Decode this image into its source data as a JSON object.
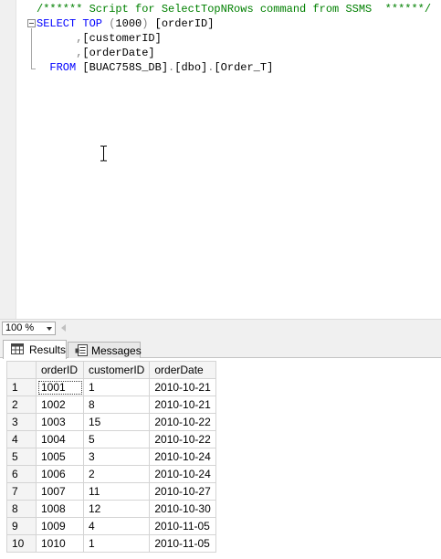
{
  "editor": {
    "lines": [
      {
        "parts": [
          {
            "t": "/****** Script for SelectTopNRows command from SSMS  ******/",
            "c": "c-comment"
          }
        ]
      },
      {
        "parts": [
          {
            "t": "SELECT TOP ",
            "c": "c-kw"
          },
          {
            "t": "(",
            "c": "c-gray"
          },
          {
            "t": "1000",
            "c": "c-plain"
          },
          {
            "t": ")",
            "c": "c-gray"
          },
          {
            "t": " [orderID]",
            "c": "c-plain"
          }
        ]
      },
      {
        "parts": [
          {
            "t": "      ",
            "c": "c-plain"
          },
          {
            "t": ",",
            "c": "c-gray"
          },
          {
            "t": "[customerID]",
            "c": "c-plain"
          }
        ]
      },
      {
        "parts": [
          {
            "t": "      ",
            "c": "c-plain"
          },
          {
            "t": ",",
            "c": "c-gray"
          },
          {
            "t": "[orderDate]",
            "c": "c-plain"
          }
        ]
      },
      {
        "parts": [
          {
            "t": "  FROM ",
            "c": "c-kw"
          },
          {
            "t": "[BUAC758S_DB]",
            "c": "c-plain"
          },
          {
            "t": ".",
            "c": "c-gray"
          },
          {
            "t": "[dbo]",
            "c": "c-plain"
          },
          {
            "t": ".",
            "c": "c-gray"
          },
          {
            "t": "[Order_T]",
            "c": "c-plain"
          }
        ]
      }
    ]
  },
  "zoom": {
    "value": "100 %"
  },
  "tabs": {
    "results": "Results",
    "messages": "Messages"
  },
  "grid": {
    "columns": [
      "orderID",
      "customerID",
      "orderDate"
    ],
    "rows": [
      [
        "1",
        "1001",
        "1",
        "2010-10-21"
      ],
      [
        "2",
        "1002",
        "8",
        "2010-10-21"
      ],
      [
        "3",
        "1003",
        "15",
        "2010-10-22"
      ],
      [
        "4",
        "1004",
        "5",
        "2010-10-22"
      ],
      [
        "5",
        "1005",
        "3",
        "2010-10-24"
      ],
      [
        "6",
        "1006",
        "2",
        "2010-10-24"
      ],
      [
        "7",
        "1007",
        "11",
        "2010-10-27"
      ],
      [
        "8",
        "1008",
        "12",
        "2010-10-30"
      ],
      [
        "9",
        "1009",
        "4",
        "2010-11-05"
      ],
      [
        "10",
        "1010",
        "1",
        "2010-11-05"
      ]
    ]
  },
  "colors": {
    "comment": "#008000",
    "keyword": "#0000ff",
    "operator": "#808080"
  },
  "icons": {
    "fold": "collapse-minus-icon",
    "results": "grid-table-icon",
    "messages": "messages-list-icon",
    "cursor": "text-ibeam-cursor"
  }
}
